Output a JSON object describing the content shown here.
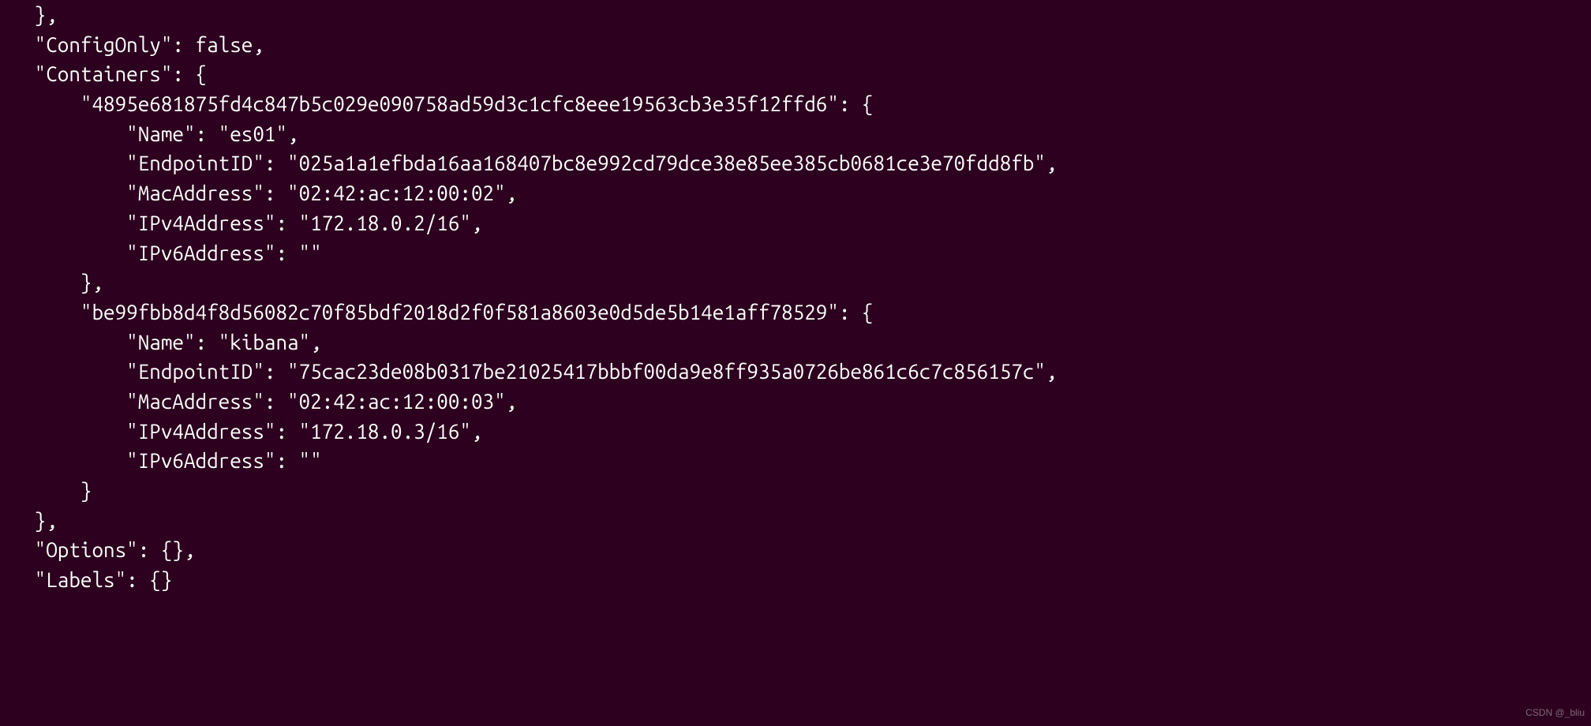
{
  "lines": {
    "l0": "   },",
    "l1": "   \"ConfigOnly\": false,",
    "l2": "   \"Containers\": {",
    "l3": "       \"4895e681875fd4c847b5c029e090758ad59d3c1cfc8eee19563cb3e35f12ffd6\": {",
    "l4": "           \"Name\": \"es01\",",
    "l5": "           \"EndpointID\": \"025a1a1efbda16aa168407bc8e992cd79dce38e85ee385cb0681ce3e70fdd8fb\",",
    "l6": "           \"MacAddress\": \"02:42:ac:12:00:02\",",
    "l7": "           \"IPv4Address\": \"172.18.0.2/16\",",
    "l8": "           \"IPv6Address\": \"\"",
    "l9": "       },",
    "l10": "       \"be99fbb8d4f8d56082c70f85bdf2018d2f0f581a8603e0d5de5b14e1aff78529\": {",
    "l11": "           \"Name\": \"kibana\",",
    "l12": "           \"EndpointID\": \"75cac23de08b0317be21025417bbbf00da9e8ff935a0726be861c6c7c856157c\",",
    "l13": "           \"MacAddress\": \"02:42:ac:12:00:03\",",
    "l14": "           \"IPv4Address\": \"172.18.0.3/16\",",
    "l15": "           \"IPv6Address\": \"\"",
    "l16": "       }",
    "l17": "   },",
    "l18": "   \"Options\": {},",
    "l19": "   \"Labels\": {}"
  },
  "watermark": "CSDN @_bliu"
}
